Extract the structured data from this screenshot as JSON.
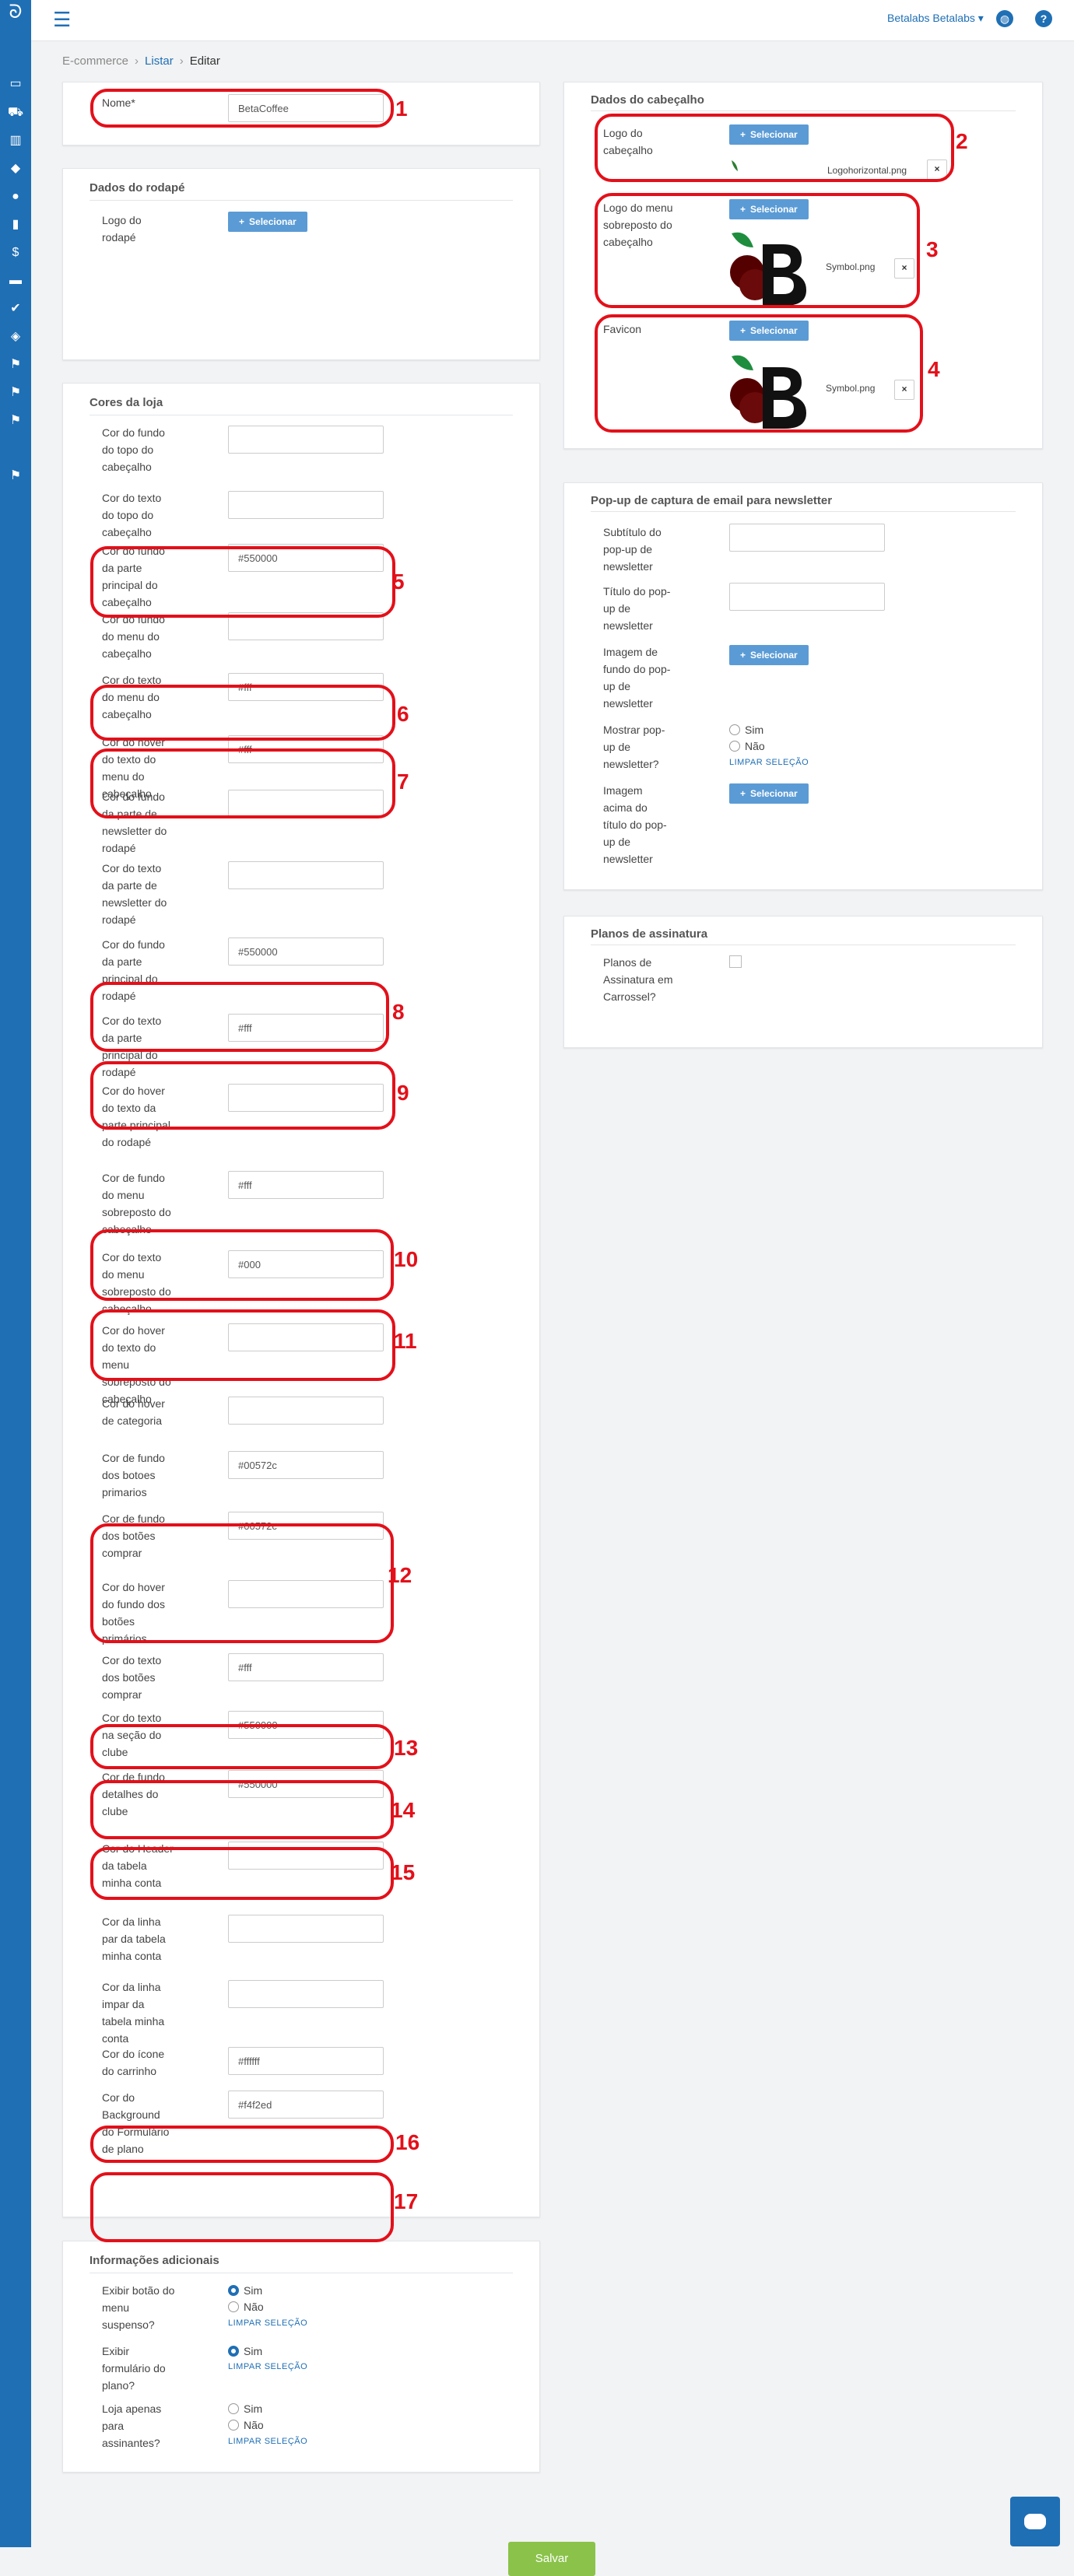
{
  "topbar": {
    "user": "Betalabs Betalabs"
  },
  "breadcrumb": {
    "root": "E-commerce",
    "list": "Listar",
    "current": "Editar"
  },
  "form": {
    "name": {
      "label": "Nome*",
      "value": "BetaCoffee"
    }
  },
  "footer_section": {
    "title": "Dados do rodapé",
    "logo_label": "Logo do rodapé",
    "select_label": "Selecionar"
  },
  "colors_section": {
    "title": "Cores da loja",
    "fields": [
      {
        "label": "Cor do fundo do topo do cabeçalho",
        "value": ""
      },
      {
        "label": "Cor do texto do topo do cabeçalho",
        "value": ""
      },
      {
        "label": "Cor do fundo da parte principal do cabeçalho",
        "value": "#550000"
      },
      {
        "label": "Cor do fundo do menu do cabeçalho",
        "value": ""
      },
      {
        "label": "Cor do texto do menu do cabeçalho",
        "value": "#fff"
      },
      {
        "label": "Cor do hover do texto do menu do cabeçalho",
        "value": "#fff"
      },
      {
        "label": "Cor do fundo da parte de newsletter do rodapé",
        "value": ""
      },
      {
        "label": "Cor do texto da parte de newsletter do rodapé",
        "value": ""
      },
      {
        "label": "Cor do fundo da parte principal do rodapé",
        "value": "#550000"
      },
      {
        "label": "Cor do texto da parte principal do rodapé",
        "value": "#fff"
      },
      {
        "label": "Cor do hover do texto da parte principal do rodapé",
        "value": ""
      },
      {
        "label": "Cor de fundo do menu sobreposto do cabeçalho",
        "value": "#fff"
      },
      {
        "label": "Cor do texto do menu sobreposto do cabeçalho",
        "value": "#000"
      },
      {
        "label": "Cor do hover do texto do menu sobreposto do cabeçalho",
        "value": ""
      },
      {
        "label": "Cor do hover de categoria",
        "value": ""
      },
      {
        "label": "Cor de fundo dos botoes primarios",
        "value": "#00572c"
      },
      {
        "label": "Cor de fundo dos botões comprar",
        "value": "#00572c"
      },
      {
        "label": "Cor do hover do fundo dos botões primários",
        "value": ""
      },
      {
        "label": "Cor do texto dos botões comprar",
        "value": "#fff"
      },
      {
        "label": "Cor do texto na seção do clube",
        "value": "#550000"
      },
      {
        "label": "Cor de fundo detalhes do clube",
        "value": "#550000"
      },
      {
        "label": "Cor do Header da tabela minha conta",
        "value": ""
      },
      {
        "label": "Cor da linha par da tabela minha conta",
        "value": ""
      },
      {
        "label": "Cor da linha impar da tabela minha conta",
        "value": ""
      },
      {
        "label": "Cor do ícone do carrinho",
        "value": "#ffffff"
      },
      {
        "label": "Cor do Background do Formulário de plano",
        "value": "#f4f2ed"
      }
    ]
  },
  "additional_section": {
    "title": "Informações adicionais",
    "options": [
      {
        "label": "Exibir botão do menu suspenso?",
        "yes": "Sim",
        "no": "Não",
        "selected": "Sim",
        "clear": "LIMPAR SELEÇÃO"
      },
      {
        "label": "Exibir formulário do plano?",
        "yes": "Sim",
        "selected": "Sim",
        "clear": "LIMPAR SELEÇÃO"
      },
      {
        "label": "Loja apenas para assinantes?",
        "yes": "Sim",
        "no": "Não",
        "selected": "",
        "clear": "LIMPAR SELEÇÃO"
      }
    ]
  },
  "header_section": {
    "title": "Dados do cabeçalho",
    "logo": {
      "label": "Logo do cabeçalho",
      "file": "Logohorizontal.png"
    },
    "overlay_logo": {
      "label": "Logo do menu sobreposto do cabeçalho",
      "file": "Symbol.png"
    },
    "favicon": {
      "label": "Favicon",
      "file": "Symbol.png"
    },
    "select_label": "Selecionar",
    "remove_label": "×"
  },
  "newsletter_section": {
    "title": "Pop-up de captura de email para newsletter",
    "subtitle_label": "Subtítulo do pop-up de newsletter",
    "title_label": "Título do pop-up de newsletter",
    "bg_image_label": "Imagem de fundo do pop-up de newsletter",
    "show_label": "Mostrar pop-up de newsletter?",
    "yes": "Sim",
    "no": "Não",
    "clear": "LIMPAR SELEÇÃO",
    "above_image_label": "Imagem acima do título do pop-up de newsletter",
    "select_label": "Selecionar"
  },
  "plans_section": {
    "title": "Planos de assinatura",
    "carousel_label": "Planos de Assinatura em Carrossel?"
  },
  "annotations": [
    "1",
    "2",
    "3",
    "4",
    "5",
    "6",
    "7",
    "8",
    "9",
    "10",
    "11",
    "12",
    "13",
    "14",
    "15",
    "16",
    "17"
  ],
  "actions": {
    "save": "Salvar"
  },
  "colors": {
    "brand": "#1f6fb5",
    "highlight": "#e3101a",
    "save": "#8bc34a",
    "select": "#5b9bd5"
  }
}
